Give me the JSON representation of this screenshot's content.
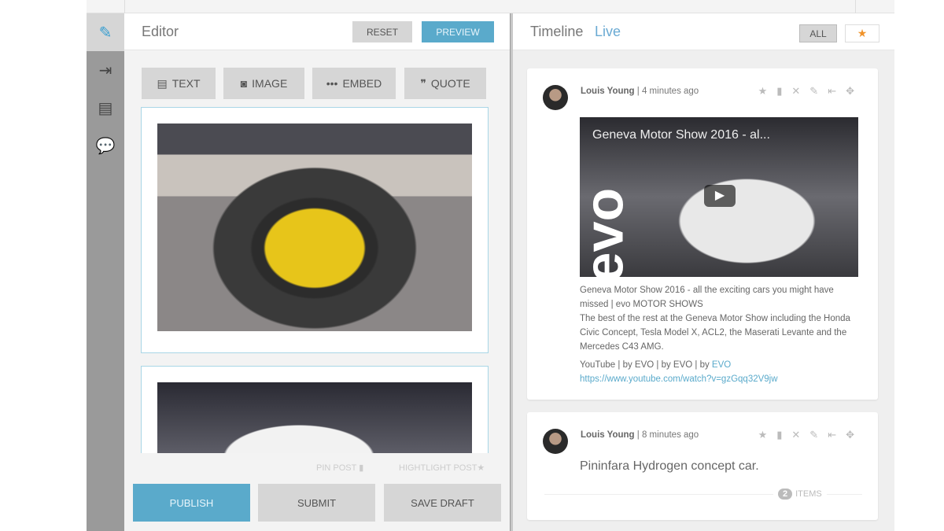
{
  "sidebar": {
    "items": [
      {
        "icon": "edit-icon"
      },
      {
        "icon": "export-icon"
      },
      {
        "icon": "archive-icon"
      },
      {
        "icon": "comment-icon"
      }
    ]
  },
  "editor": {
    "title": "Editor",
    "reset": "RESET",
    "preview": "PREVIEW",
    "tools": [
      {
        "icon": "text-icon",
        "label": "TEXT"
      },
      {
        "icon": "camera-icon",
        "label": "IMAGE"
      },
      {
        "icon": "embed-icon",
        "label": "EMBED"
      },
      {
        "icon": "quote-icon",
        "label": "QUOTE"
      }
    ],
    "pin_post": "PIN POST",
    "highlight_post": "HIGHTLIGHT POST",
    "publish": "PUBLISH",
    "submit": "SUBMIT",
    "save_draft": "SAVE DRAFT"
  },
  "timeline": {
    "title": "Timeline",
    "live": "Live",
    "filter_all": "ALL",
    "filter_star": "★",
    "posts": [
      {
        "author": "Louis Young",
        "time": "| 4 minutes ago",
        "video_title": "Geneva Motor Show 2016 - al...",
        "video_logo": "evo",
        "desc1": "Geneva Motor Show 2016 - all the exciting cars you might have missed | evo MOTOR SHOWS",
        "desc2": "The best of the rest at the Geneva Motor Show including the Honda Civic Concept, Tesla Model X, ACL2, the Maserati Levante and the Mercedes C43 AMG.",
        "source": "YouTube | by EVO | by EVO | by ",
        "source_link": "EVO",
        "url": "https://www.youtube.com/watch?v=gzGqq32V9jw"
      },
      {
        "author": "Louis Young",
        "time": "| 8 minutes ago",
        "text": "Pininfara Hydrogen concept car.",
        "items_count": "2",
        "items_label": "ITEMS"
      }
    ]
  },
  "colors": {
    "accent": "#5aaacb",
    "star": "#f0932b"
  }
}
